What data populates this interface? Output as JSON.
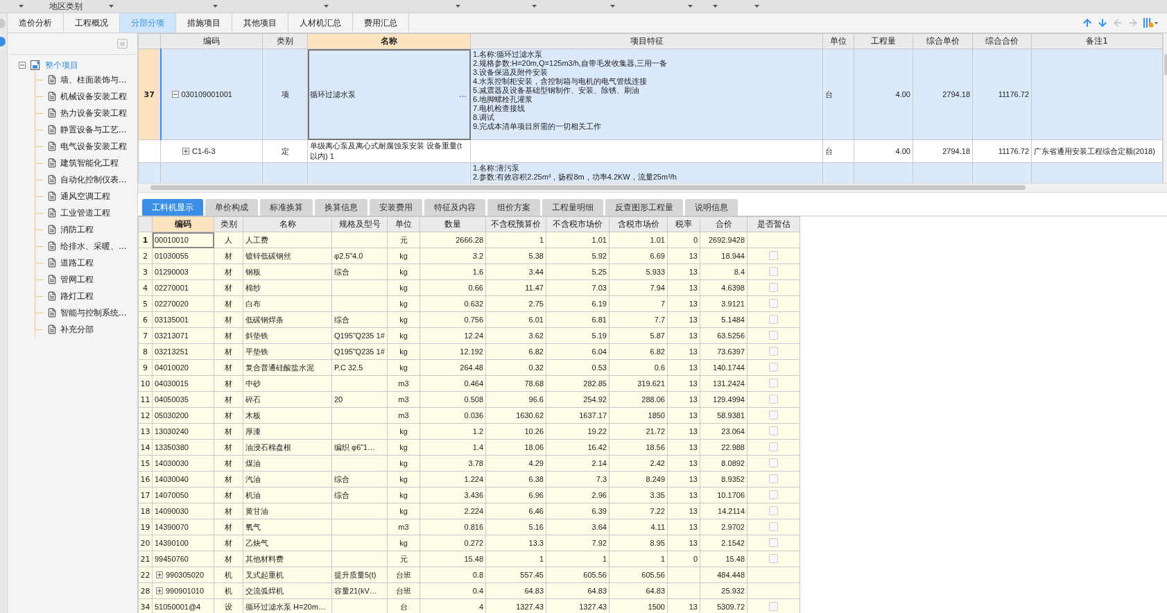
{
  "header_strip": {
    "label": "地区类别"
  },
  "main_tabs": [
    {
      "label": "造价分析",
      "selected": false
    },
    {
      "label": "工程概况",
      "selected": false
    },
    {
      "label": "分部分项",
      "selected": true
    },
    {
      "label": "措施项目",
      "selected": false
    },
    {
      "label": "其他项目",
      "selected": false
    },
    {
      "label": "人材机汇总",
      "selected": false
    },
    {
      "label": "费用汇总",
      "selected": false
    }
  ],
  "toolbar": [
    {
      "kind": "up",
      "disabled": false
    },
    {
      "kind": "down",
      "disabled": false
    },
    {
      "kind": "left",
      "disabled": true
    },
    {
      "kind": "right",
      "disabled": true
    },
    {
      "kind": "columns",
      "disabled": false
    }
  ],
  "tree": {
    "root": {
      "label": "整个项目",
      "expanded": true,
      "selected": true
    },
    "children": [
      {
        "label": "墙、柱面装饰与..."
      },
      {
        "label": "机械设备安装工程"
      },
      {
        "label": "热力设备安装工程"
      },
      {
        "label": "静置设备与工艺..."
      },
      {
        "label": "电气设备安装工程"
      },
      {
        "label": "建筑智能化工程"
      },
      {
        "label": "自动化控制仪表..."
      },
      {
        "label": "通风空调工程"
      },
      {
        "label": "工业管道工程"
      },
      {
        "label": "消防工程"
      },
      {
        "label": "给排水、采暖、..."
      },
      {
        "label": "道路工程"
      },
      {
        "label": "管网工程"
      },
      {
        "label": "路灯工程"
      },
      {
        "label": "智能与控制系统..."
      },
      {
        "label": "补充分部"
      }
    ]
  },
  "top_table": {
    "columns": [
      "编码",
      "类别",
      "名称",
      "项目特征",
      "单位",
      "工程量",
      "综合单价",
      "综合合价",
      "备注1"
    ],
    "rows": [
      {
        "kind": "bill",
        "selected": true,
        "number": "37",
        "expanded": true,
        "code": "030109001001",
        "type": "项",
        "name": "循环过滤水泵",
        "more": "…",
        "features": [
          "1.名称:循环过滤水泵",
          "2.规格参数:H=20m,Q=125m3/h,自带毛发收集器,三用一备",
          "3.设备保温及附件安装",
          "4.水泵控制柜安装，含控制箱与电机的电气管线连接",
          "5.减震器及设备基础型钢制作、安装、除锈、刷油",
          "6.地脚螺栓孔灌浆",
          "7.电机检查接线",
          "8.调试",
          "9.完成本清单项目所需的一切相关工作"
        ],
        "unit": "台",
        "qty": "4.00",
        "price": "2794.18",
        "total": "11176.72"
      },
      {
        "kind": "quota",
        "selected": false,
        "expanded": false,
        "code": "C1-6-3",
        "type": "定",
        "name": "单级离心泵及离心式耐腐蚀泵安装 设备重量(t以内) 1",
        "unit": "台",
        "qty": "4.00",
        "price": "2794.18",
        "total": "11176.72",
        "remark": "广东省通用安装工程综合定额(2018)"
      },
      {
        "kind": "bill",
        "selected": false,
        "features": [
          "1.名称:潜污泵",
          "2.参数:有效容积2.25m³，扬程8m，功率4.2KW，流量25m³/h"
        ]
      }
    ]
  },
  "sub_tabs": [
    {
      "label": "工料机显示",
      "selected": true
    },
    {
      "label": "单价构成",
      "selected": false
    },
    {
      "label": "标准换算",
      "selected": false
    },
    {
      "label": "换算信息",
      "selected": false
    },
    {
      "label": "安装费用",
      "selected": false
    },
    {
      "label": "特征及内容",
      "selected": false
    },
    {
      "label": "组价方案",
      "selected": false
    },
    {
      "label": "工程量明细",
      "selected": false
    },
    {
      "label": "反查图形工程量",
      "selected": false
    },
    {
      "label": "说明信息",
      "selected": false
    }
  ],
  "material_grid": {
    "columns": [
      "编码",
      "类别",
      "名称",
      "规格及型号",
      "单位",
      "数量",
      "不含税预算价",
      "不含税市场价",
      "含税市场价",
      "税率",
      "合价",
      "是否暂估"
    ],
    "rows": [
      {
        "no": "1",
        "selected": true,
        "code": "00010010",
        "type": "人",
        "name": "人工费",
        "unit": "元",
        "qty": "2666.28",
        "budget": "1",
        "market": "1.01",
        "tax_market": "1.01",
        "rate": "0",
        "total": "2692.9428"
      },
      {
        "no": "2",
        "selected": false,
        "code": "01030055",
        "type": "材",
        "name": "镀锌低碳钢丝",
        "spec": "φ2.5˜4.0",
        "unit": "kg",
        "qty": "3.2",
        "budget": "5.38",
        "market": "5.92",
        "tax_market": "6.69",
        "rate": "13",
        "total": "18.944",
        "checked": false
      },
      {
        "no": "3",
        "selected": false,
        "code": "01290003",
        "type": "材",
        "name": "钢板",
        "spec": "综合",
        "unit": "kg",
        "qty": "1.6",
        "budget": "3.44",
        "market": "5.25",
        "tax_market": "5.933",
        "rate": "13",
        "total": "8.4",
        "checked": false
      },
      {
        "no": "4",
        "selected": false,
        "code": "02270001",
        "type": "材",
        "name": "棉纱",
        "unit": "kg",
        "qty": "0.66",
        "budget": "11.47",
        "market": "7.03",
        "tax_market": "7.94",
        "rate": "13",
        "total": "4.6398",
        "checked": false
      },
      {
        "no": "5",
        "selected": false,
        "code": "02270020",
        "type": "材",
        "name": "白布",
        "unit": "kg",
        "qty": "0.632",
        "budget": "2.75",
        "market": "6.19",
        "tax_market": "7",
        "rate": "13",
        "total": "3.9121",
        "checked": false
      },
      {
        "no": "6",
        "selected": false,
        "code": "03135001",
        "type": "材",
        "name": "低碳钢焊条",
        "spec": "综合",
        "unit": "kg",
        "qty": "0.756",
        "budget": "6.01",
        "market": "6.81",
        "tax_market": "7.7",
        "rate": "13",
        "total": "5.1484",
        "checked": false
      },
      {
        "no": "7",
        "selected": false,
        "code": "03213071",
        "type": "材",
        "name": "斜垫铁",
        "spec": "Q195˜Q235 1#",
        "unit": "kg",
        "qty": "12.24",
        "budget": "3.62",
        "market": "5.19",
        "tax_market": "5.87",
        "rate": "13",
        "total": "63.5256",
        "checked": false
      },
      {
        "no": "8",
        "selected": false,
        "code": "03213251",
        "type": "材",
        "name": "平垫铁",
        "spec": "Q195˜Q235 1#",
        "unit": "kg",
        "qty": "12.192",
        "budget": "6.82",
        "market": "6.04",
        "tax_market": "6.82",
        "rate": "13",
        "total": "73.6397",
        "checked": false
      },
      {
        "no": "9",
        "selected": false,
        "code": "04010020",
        "type": "材",
        "name": "复合普通硅酸盐水泥",
        "spec": "P.C 32.5",
        "unit": "kg",
        "qty": "264.48",
        "budget": "0.32",
        "market": "0.53",
        "tax_market": "0.6",
        "rate": "13",
        "total": "140.1744",
        "checked": false
      },
      {
        "no": "10",
        "selected": false,
        "code": "04030015",
        "type": "材",
        "name": "中砂",
        "unit": "m3",
        "qty": "0.464",
        "budget": "78.68",
        "market": "282.85",
        "tax_market": "319.621",
        "rate": "13",
        "total": "131.2424",
        "checked": false
      },
      {
        "no": "11",
        "selected": false,
        "code": "04050035",
        "type": "材",
        "name": "碎石",
        "spec": "20",
        "unit": "m3",
        "qty": "0.508",
        "budget": "96.6",
        "market": "254.92",
        "tax_market": "288.06",
        "rate": "13",
        "total": "129.4994",
        "checked": false
      },
      {
        "no": "12",
        "selected": false,
        "code": "05030200",
        "type": "材",
        "name": "木板",
        "unit": "m3",
        "qty": "0.036",
        "budget": "1630.62",
        "market": "1637.17",
        "tax_market": "1850",
        "rate": "13",
        "total": "58.9381",
        "checked": false
      },
      {
        "no": "13",
        "selected": false,
        "code": "13030240",
        "type": "材",
        "name": "厚漆",
        "unit": "kg",
        "qty": "1.2",
        "budget": "10.26",
        "market": "19.22",
        "tax_market": "21.72",
        "rate": "13",
        "total": "23.064",
        "checked": false
      },
      {
        "no": "14",
        "selected": false,
        "code": "13350380",
        "type": "材",
        "name": "油浸石棉盘根",
        "spec": "编织 φ6˜1…",
        "unit": "kg",
        "qty": "1.4",
        "budget": "18.06",
        "market": "16.42",
        "tax_market": "18.56",
        "rate": "13",
        "total": "22.988",
        "checked": false
      },
      {
        "no": "15",
        "selected": false,
        "code": "14030030",
        "type": "材",
        "name": "煤油",
        "unit": "kg",
        "qty": "3.78",
        "budget": "4.29",
        "market": "2.14",
        "tax_market": "2.42",
        "rate": "13",
        "total": "8.0892",
        "checked": false
      },
      {
        "no": "16",
        "selected": false,
        "code": "14030040",
        "type": "材",
        "name": "汽油",
        "spec": "综合",
        "unit": "kg",
        "qty": "1.224",
        "budget": "6.38",
        "market": "7.3",
        "tax_market": "8.249",
        "rate": "13",
        "total": "8.9352",
        "checked": false
      },
      {
        "no": "17",
        "selected": false,
        "code": "14070050",
        "type": "材",
        "name": "机油",
        "spec": "综合",
        "unit": "kg",
        "qty": "3.436",
        "budget": "6.96",
        "market": "2.96",
        "tax_market": "3.35",
        "rate": "13",
        "total": "10.1706",
        "checked": false
      },
      {
        "no": "18",
        "selected": false,
        "code": "14090030",
        "type": "材",
        "name": "黄甘油",
        "unit": "kg",
        "qty": "2.224",
        "budget": "6.46",
        "market": "6.39",
        "tax_market": "7.22",
        "rate": "13",
        "total": "14.2114",
        "checked": false
      },
      {
        "no": "19",
        "selected": false,
        "code": "14390070",
        "type": "材",
        "name": "氧气",
        "unit": "m3",
        "qty": "0.816",
        "budget": "5.16",
        "market": "3.64",
        "tax_market": "4.11",
        "rate": "13",
        "total": "2.9702",
        "checked": false
      },
      {
        "no": "20",
        "selected": false,
        "code": "14390100",
        "type": "材",
        "name": "乙炔气",
        "unit": "kg",
        "qty": "0.272",
        "budget": "13.3",
        "market": "7.92",
        "tax_market": "8.95",
        "rate": "13",
        "total": "2.1542",
        "checked": false
      },
      {
        "no": "21",
        "selected": false,
        "code": "99450760",
        "type": "材",
        "name": "其他材料费",
        "unit": "元",
        "qty": "15.48",
        "budget": "1",
        "market": "1",
        "tax_market": "1",
        "rate": "0",
        "total": "15.48",
        "checked": false
      },
      {
        "no": "22",
        "selected": false,
        "expanded": false,
        "code": "990305020",
        "type": "机",
        "name": "叉式起重机",
        "spec": "提升质量5(t)",
        "unit": "台班",
        "qty": "0.8",
        "budget": "557.45",
        "market": "605.56",
        "tax_market": "605.56",
        "total": "484.448"
      },
      {
        "no": "28",
        "selected": false,
        "expanded": false,
        "code": "990901010",
        "type": "机",
        "name": "交流弧焊机",
        "spec": "容量21(kV…",
        "unit": "台班",
        "qty": "0.4",
        "budget": "64.83",
        "market": "64.83",
        "tax_market": "64.83",
        "total": "25.932"
      },
      {
        "no": "34",
        "selected": false,
        "code": "51050001@4",
        "type": "设",
        "name": "循环过滤水泵 H=20m…",
        "unit": "台",
        "qty": "4",
        "budget": "1327.43",
        "market": "1327.43",
        "tax_market": "1500",
        "rate": "13",
        "total": "5309.72",
        "checked": false
      }
    ]
  }
}
